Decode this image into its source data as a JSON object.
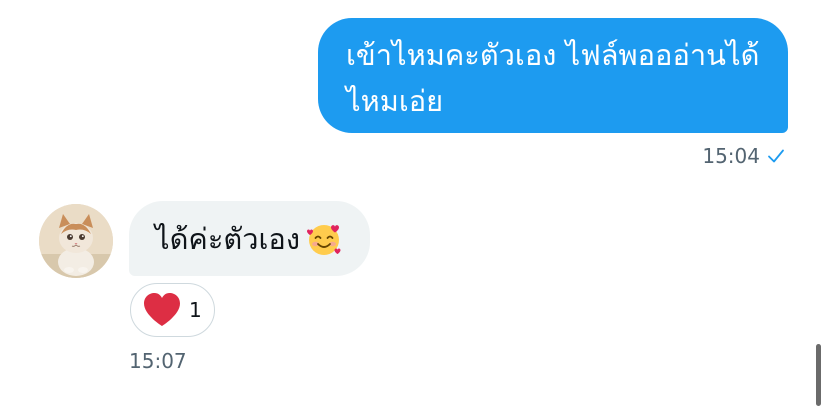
{
  "conversation": {
    "outgoing": {
      "text": "เข้าไหมคะตัวเอง ไฟล์พอออ่านได้ไหมเอ่ย",
      "time": "15:04",
      "status_icon": "check-icon"
    },
    "incoming": {
      "text": "ได้ค่ะตัวเอง",
      "emoji_icon": "smiling-face-with-hearts-icon",
      "avatar_icon": "kitten-avatar-icon",
      "time": "15:07",
      "reaction": {
        "icon": "red-heart-icon",
        "count": "1"
      }
    }
  },
  "colors": {
    "outgoing_bubble": "#1d9bf0",
    "incoming_bubble": "#eff3f4",
    "meta_text": "#536471",
    "heart": "#e0245e"
  }
}
